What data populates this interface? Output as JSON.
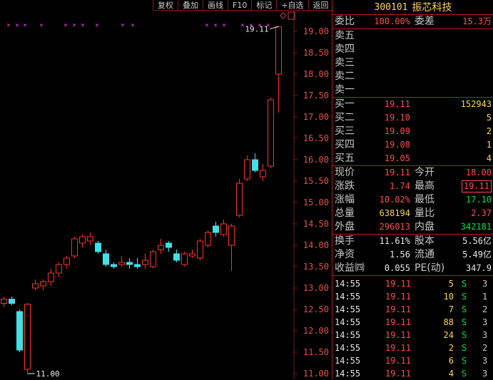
{
  "toolbar": {
    "buttons": [
      "复权",
      "叠加",
      "画线",
      "F10",
      "标记",
      "+自选",
      "返回"
    ]
  },
  "header": {
    "code": "300101",
    "name": "振芯科技"
  },
  "commission": {
    "ratio_label": "委比",
    "ratio_value": "100.00%",
    "diff_label": "委差",
    "diff_value": "15.3万"
  },
  "sell_levels": [
    {
      "label": "卖五"
    },
    {
      "label": "卖四"
    },
    {
      "label": "卖三"
    },
    {
      "label": "卖二"
    },
    {
      "label": "卖一"
    }
  ],
  "buy_levels": [
    {
      "label": "买一",
      "price": "19.11",
      "vol": "152943"
    },
    {
      "label": "买二",
      "price": "19.10",
      "vol": "5"
    },
    {
      "label": "买三",
      "price": "19.09",
      "vol": "2"
    },
    {
      "label": "买四",
      "price": "19.08",
      "vol": "1"
    },
    {
      "label": "买五",
      "price": "19.05",
      "vol": "4"
    }
  ],
  "stats": {
    "price_label": "现价",
    "price": "19.11",
    "open_label": "今开",
    "open": "18.00",
    "change_label": "涨跌",
    "change": "1.74",
    "high_label": "最高",
    "high": "19.11",
    "pct_label": "涨幅",
    "pct": "10.02%",
    "low_label": "最低",
    "low": "17.10",
    "vol_label": "总量",
    "vol": "638194",
    "volratio_label": "量比",
    "volratio": "2.37",
    "outer_label": "外盘",
    "outer": "296013",
    "inner_label": "内盘",
    "inner": "342181"
  },
  "fundamentals": {
    "turnover_label": "换手",
    "turnover": "11.61%",
    "capital_label": "股本",
    "capital": "5.56亿",
    "netasset_label": "净资",
    "netasset": "1.56",
    "float_label": "流通",
    "float": "5.49亿",
    "eps_label": "收益㈣",
    "eps": "0.055",
    "pe_label": "PE(动)",
    "pe": "347.9"
  },
  "ticks": [
    {
      "time": "14:55",
      "price": "19.11",
      "vol": "5",
      "side": "S",
      "n": "3"
    },
    {
      "time": "14:55",
      "price": "19.11",
      "vol": "10",
      "side": "S",
      "n": "1"
    },
    {
      "time": "14:55",
      "price": "19.11",
      "vol": "7",
      "side": "S",
      "n": "2"
    },
    {
      "time": "14:55",
      "price": "19.11",
      "vol": "88",
      "side": "S",
      "n": "3"
    },
    {
      "time": "14:55",
      "price": "19.11",
      "vol": "24",
      "side": "S",
      "n": "3"
    },
    {
      "time": "14:55",
      "price": "19.11",
      "vol": "2",
      "side": "S",
      "n": "2"
    },
    {
      "time": "14:55",
      "price": "19.11",
      "vol": "6",
      "side": "S",
      "n": "3"
    },
    {
      "time": "14:55",
      "price": "19.11",
      "vol": "4",
      "side": "S",
      "n": "3"
    }
  ],
  "chart_data": {
    "type": "candlestick",
    "y_ticks": [
      "19.00",
      "18.50",
      "18.00",
      "17.50",
      "17.00",
      "16.50",
      "16.00",
      "15.50",
      "15.00",
      "14.50",
      "14.00",
      "13.50",
      "13.00",
      "12.50",
      "12.00",
      "11.50",
      "11.00"
    ],
    "ylim": [
      11.0,
      19.0
    ],
    "high_marker": "19.11",
    "low_marker": "11.00",
    "colors": {
      "up": "#ff3030",
      "down": "#40e0e8",
      "marker": "#ff40ff",
      "grid": "#7a1c1c"
    },
    "candles": [
      {
        "o": 12.64,
        "c": 12.74,
        "h": 12.8,
        "l": 12.55
      },
      {
        "o": 12.74,
        "c": 12.64,
        "h": 12.8,
        "l": 12.6
      },
      {
        "o": 12.45,
        "c": 11.55,
        "h": 12.5,
        "l": 11.5
      },
      {
        "o": 11.1,
        "c": 12.62,
        "h": 12.65,
        "l": 11.0
      },
      {
        "o": 13.0,
        "c": 13.1,
        "h": 13.2,
        "l": 12.95
      },
      {
        "o": 13.05,
        "c": 13.15,
        "h": 13.2,
        "l": 12.95
      },
      {
        "o": 13.15,
        "c": 13.35,
        "h": 13.45,
        "l": 13.05
      },
      {
        "o": 13.35,
        "c": 13.55,
        "h": 13.6,
        "l": 13.25
      },
      {
        "o": 13.55,
        "c": 13.7,
        "h": 13.75,
        "l": 13.45
      },
      {
        "o": 13.75,
        "c": 14.15,
        "h": 14.2,
        "l": 13.7
      },
      {
        "o": 14.05,
        "c": 14.2,
        "h": 14.25,
        "l": 13.95
      },
      {
        "o": 14.1,
        "c": 14.2,
        "h": 14.3,
        "l": 14.0
      },
      {
        "o": 14.05,
        "c": 13.85,
        "h": 14.1,
        "l": 13.8
      },
      {
        "o": 13.8,
        "c": 13.55,
        "h": 13.9,
        "l": 13.5
      },
      {
        "o": 13.55,
        "c": 13.5,
        "h": 13.6,
        "l": 13.45
      },
      {
        "o": 13.55,
        "c": 13.6,
        "h": 13.75,
        "l": 13.5
      },
      {
        "o": 13.6,
        "c": 13.55,
        "h": 13.7,
        "l": 13.45
      },
      {
        "o": 13.55,
        "c": 13.5,
        "h": 13.7,
        "l": 13.45
      },
      {
        "o": 13.55,
        "c": 13.65,
        "h": 13.8,
        "l": 13.45
      },
      {
        "o": 13.5,
        "c": 13.85,
        "h": 13.9,
        "l": 13.45
      },
      {
        "o": 13.9,
        "c": 14.0,
        "h": 14.15,
        "l": 13.8
      },
      {
        "o": 14.05,
        "c": 13.95,
        "h": 14.1,
        "l": 13.85
      },
      {
        "o": 13.8,
        "c": 13.65,
        "h": 13.9,
        "l": 13.6
      },
      {
        "o": 13.55,
        "c": 13.8,
        "h": 13.85,
        "l": 13.5
      },
      {
        "o": 13.75,
        "c": 13.8,
        "h": 13.9,
        "l": 13.7
      },
      {
        "o": 13.7,
        "c": 14.1,
        "h": 14.15,
        "l": 13.65
      },
      {
        "o": 14.0,
        "c": 14.3,
        "h": 14.35,
        "l": 13.95
      },
      {
        "o": 14.45,
        "c": 14.3,
        "h": 14.55,
        "l": 14.2
      },
      {
        "o": 14.25,
        "c": 14.5,
        "h": 14.6,
        "l": 14.2
      },
      {
        "o": 14.0,
        "c": 14.45,
        "h": 14.5,
        "l": 13.4
      },
      {
        "o": 14.7,
        "c": 15.45,
        "h": 15.55,
        "l": 14.65
      },
      {
        "o": 15.55,
        "c": 16.0,
        "h": 16.1,
        "l": 15.5
      },
      {
        "o": 16.0,
        "c": 15.75,
        "h": 16.15,
        "l": 15.7
      },
      {
        "o": 15.6,
        "c": 15.75,
        "h": 15.9,
        "l": 15.5
      },
      {
        "o": 15.85,
        "c": 17.4,
        "h": 17.45,
        "l": 15.8
      },
      {
        "o": 18.0,
        "c": 19.11,
        "h": 19.11,
        "l": 17.1
      }
    ]
  }
}
